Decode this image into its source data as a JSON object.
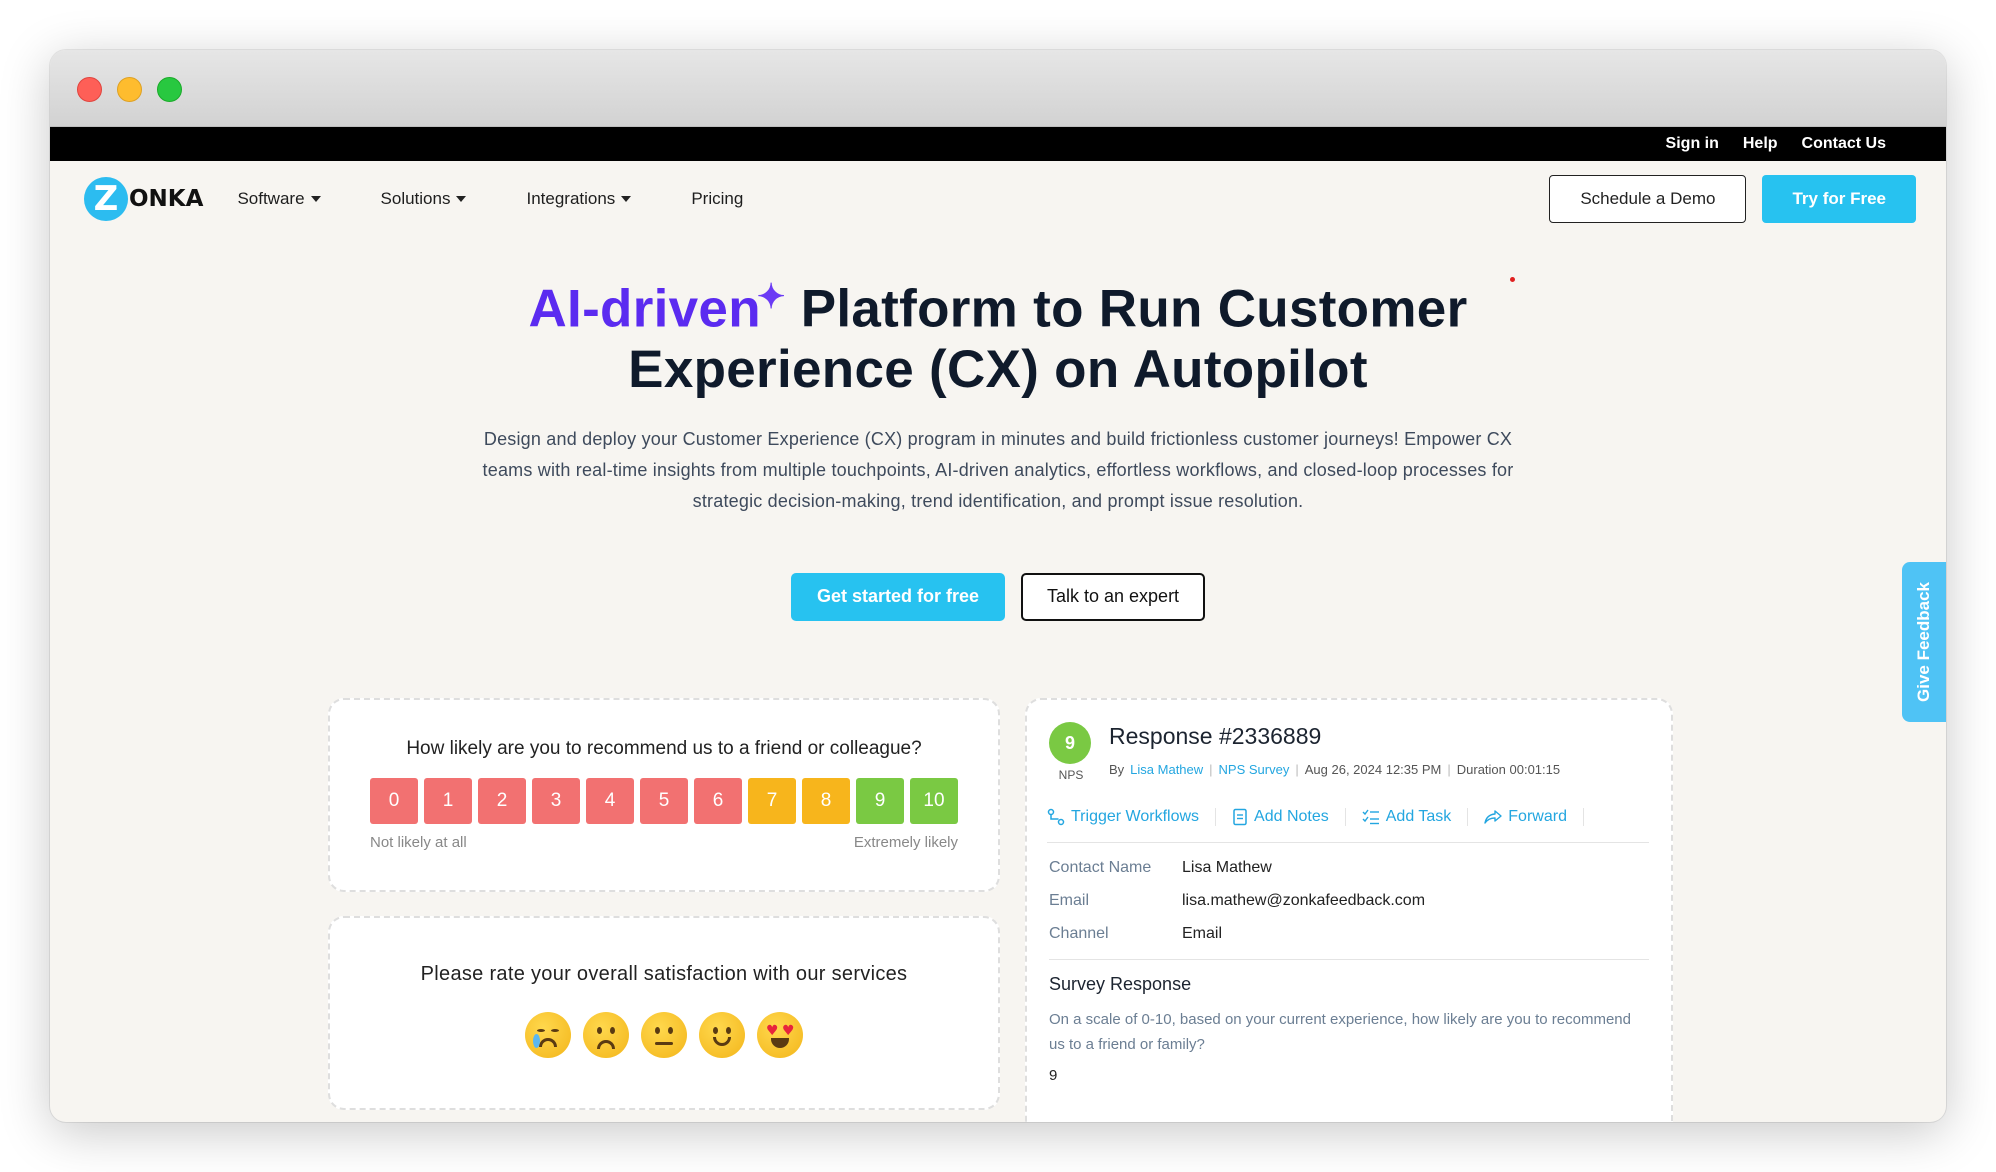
{
  "topbar": {
    "sign_in": "Sign in",
    "help": "Help",
    "contact": "Contact Us"
  },
  "nav": {
    "logo_letter": "Z",
    "logo_rest": "ONKA",
    "items": [
      "Software",
      "Solutions",
      "Integrations",
      "Pricing"
    ],
    "schedule_demo": "Schedule a Demo",
    "try_free": "Try for Free"
  },
  "hero": {
    "headline_ai": "AI-driven",
    "sparkle": "✦",
    "headline_rest1": " Platform to Run Customer",
    "headline_line2": "Experience (CX) on Autopilot",
    "subtext": "Design and deploy your Customer Experience (CX) program in minutes and build frictionless customer journeys! Empower CX teams with real-time insights from multiple touchpoints, AI-driven analytics, effortless workflows, and closed-loop processes for strategic decision-making, trend identification, and prompt issue resolution.",
    "cta_primary": "Get started for free",
    "cta_secondary": "Talk to an expert"
  },
  "nps_card": {
    "question": "How likely are you to recommend us to a friend or colleague?",
    "scale": [
      "0",
      "1",
      "2",
      "3",
      "4",
      "5",
      "6",
      "7",
      "8",
      "9",
      "10"
    ],
    "scale_colors": [
      "#f27171",
      "#f27171",
      "#f27171",
      "#f27171",
      "#f27171",
      "#f27171",
      "#f27171",
      "#f7b51c",
      "#f7b51c",
      "#7ac943",
      "#7ac943"
    ],
    "low_label": "Not likely at all",
    "high_label": "Extremely likely"
  },
  "csat_card": {
    "question": "Please rate your overall satisfaction with our services",
    "faces": [
      "crying-face-icon",
      "frowning-face-icon",
      "neutral-face-icon",
      "smiling-face-icon",
      "heart-eyes-face-icon"
    ]
  },
  "response_card": {
    "score": "9",
    "score_label": "NPS",
    "title": "Response #2336889",
    "by": "By",
    "author": "Lisa Mathew",
    "survey": "NPS Survey",
    "date": "Aug 26, 2024 12:35 PM",
    "duration": "Duration 00:01:15",
    "actions": [
      "Trigger Workflows",
      "Add Notes",
      "Add Task",
      "Forward"
    ],
    "fields": [
      {
        "k": "Contact Name",
        "v": "Lisa Mathew"
      },
      {
        "k": "Email",
        "v": "lisa.mathew@zonkafeedback.com"
      },
      {
        "k": "Channel",
        "v": "Email"
      }
    ],
    "survey_heading": "Survey Response",
    "survey_question": "On a scale of 0-10, based on your current experience, how likely are you to recommend us to a friend or family?",
    "survey_answer": "9"
  },
  "feedback_tab": "Give Feedback",
  "colors": {
    "accent": "#27c2f0",
    "brand_purple": "#5b2bf0",
    "nps_green": "#7ac943"
  }
}
